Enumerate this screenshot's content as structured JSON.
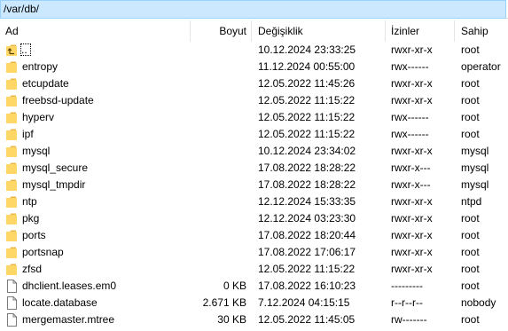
{
  "path": "/var/db/",
  "columns": {
    "name": "Ad",
    "size": "Boyut",
    "modified": "Değişiklik",
    "permissions": "İzinler",
    "owner": "Sahip"
  },
  "colors": {
    "selection_fill": "#cce8ff",
    "selection_border": "#99d1ff",
    "folder_fill": "#ffd766",
    "folder_dark": "#e8b84a"
  },
  "rows": [
    {
      "name": "..",
      "size": "",
      "modified": "10.12.2024 23:33:25",
      "permissions": "rwxr-xr-x",
      "owner": "root",
      "icon": "parent-folder-icon"
    },
    {
      "name": "entropy",
      "size": "",
      "modified": "11.12.2024 00:55:00",
      "permissions": "rwx------",
      "owner": "operator",
      "icon": "folder-icon"
    },
    {
      "name": "etcupdate",
      "size": "",
      "modified": "12.05.2022 11:45:26",
      "permissions": "rwxr-xr-x",
      "owner": "root",
      "icon": "folder-icon"
    },
    {
      "name": "freebsd-update",
      "size": "",
      "modified": "12.05.2022 11:15:22",
      "permissions": "rwxr-xr-x",
      "owner": "root",
      "icon": "folder-icon"
    },
    {
      "name": "hyperv",
      "size": "",
      "modified": "12.05.2022 11:15:22",
      "permissions": "rwx------",
      "owner": "root",
      "icon": "folder-icon"
    },
    {
      "name": "ipf",
      "size": "",
      "modified": "12.05.2022 11:15:22",
      "permissions": "rwx------",
      "owner": "root",
      "icon": "folder-icon"
    },
    {
      "name": "mysql",
      "size": "",
      "modified": "10.12.2024 23:34:02",
      "permissions": "rwxr-xr-x",
      "owner": "mysql",
      "icon": "folder-icon"
    },
    {
      "name": "mysql_secure",
      "size": "",
      "modified": "17.08.2022 18:28:22",
      "permissions": "rwxr-x---",
      "owner": "mysql",
      "icon": "folder-icon"
    },
    {
      "name": "mysql_tmpdir",
      "size": "",
      "modified": "17.08.2022 18:28:22",
      "permissions": "rwxr-x---",
      "owner": "mysql",
      "icon": "folder-icon"
    },
    {
      "name": "ntp",
      "size": "",
      "modified": "12.12.2024 15:33:35",
      "permissions": "rwxr-xr-x",
      "owner": "ntpd",
      "icon": "folder-icon"
    },
    {
      "name": "pkg",
      "size": "",
      "modified": "12.12.2024 03:23:30",
      "permissions": "rwxr-xr-x",
      "owner": "root",
      "icon": "folder-icon"
    },
    {
      "name": "ports",
      "size": "",
      "modified": "17.08.2022 18:20:44",
      "permissions": "rwxr-xr-x",
      "owner": "root",
      "icon": "folder-icon"
    },
    {
      "name": "portsnap",
      "size": "",
      "modified": "17.08.2022 17:06:17",
      "permissions": "rwxr-xr-x",
      "owner": "root",
      "icon": "folder-icon"
    },
    {
      "name": "zfsd",
      "size": "",
      "modified": "12.05.2022 11:15:22",
      "permissions": "rwxr-xr-x",
      "owner": "root",
      "icon": "folder-icon"
    },
    {
      "name": "dhclient.leases.em0",
      "size": "0 KB",
      "modified": "17.08.2022 16:10:23",
      "permissions": "---------",
      "owner": "root",
      "icon": "file-icon"
    },
    {
      "name": "locate.database",
      "size": "2.671 KB",
      "modified": "7.12.2024 04:15:15",
      "permissions": "r--r--r--",
      "owner": "nobody",
      "icon": "file-icon"
    },
    {
      "name": "mergemaster.mtree",
      "size": "30 KB",
      "modified": "12.05.2022 11:45:05",
      "permissions": "rw-------",
      "owner": "root",
      "icon": "file-icon"
    }
  ]
}
